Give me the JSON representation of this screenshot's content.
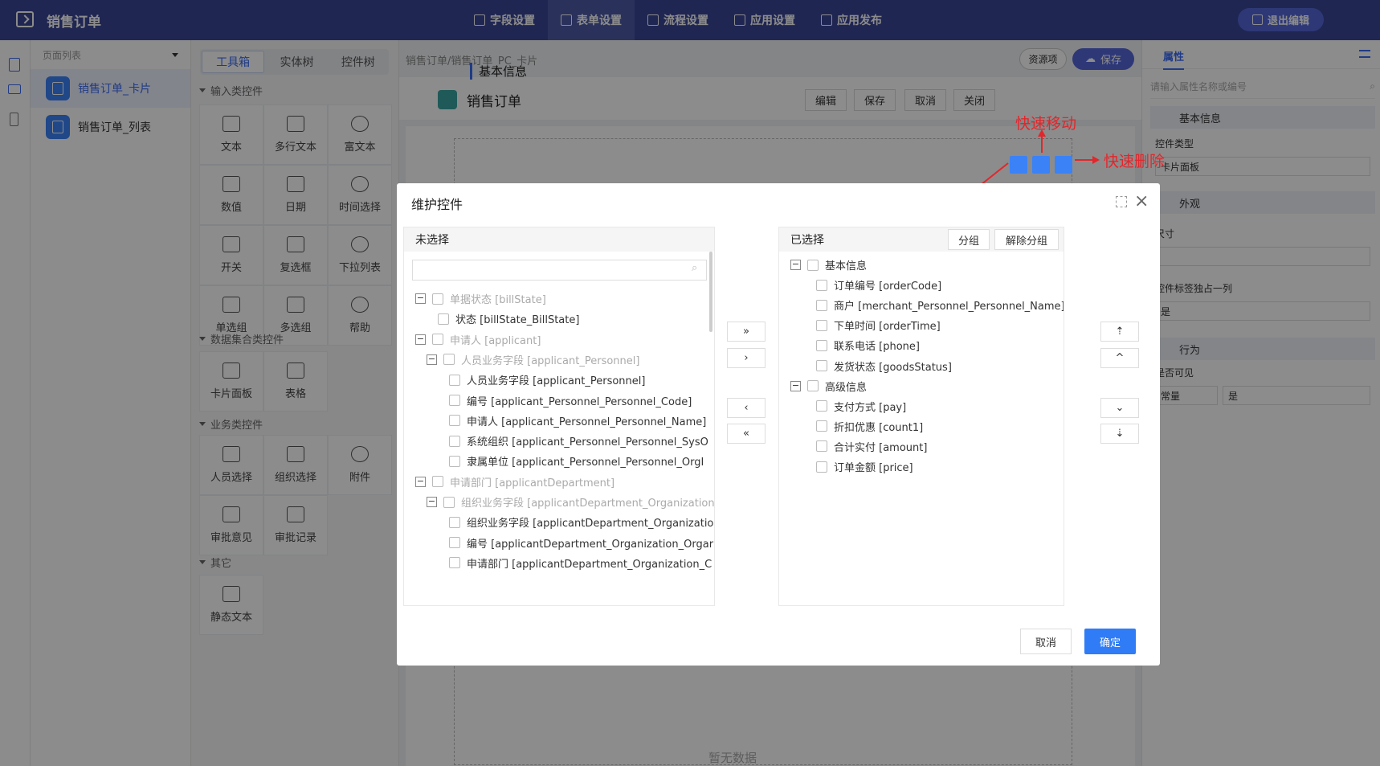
{
  "app": {
    "title": "销售订单",
    "exit_label": "退出编辑"
  },
  "topnav": [
    {
      "label": "字段设置",
      "active": false
    },
    {
      "label": "表单设置",
      "active": true
    },
    {
      "label": "流程设置",
      "active": false
    },
    {
      "label": "应用设置",
      "active": false
    },
    {
      "label": "应用发布",
      "active": false
    }
  ],
  "pagelist": {
    "header": "页面列表",
    "items": [
      {
        "label": "销售订单_卡片",
        "selected": true
      },
      {
        "label": "销售订单_列表",
        "selected": false
      }
    ]
  },
  "toolbox": {
    "tabs": [
      "工具箱",
      "实体树",
      "控件树"
    ],
    "sections": [
      {
        "title": "输入类控件",
        "items": [
          "文本",
          "多行文本",
          "富文本",
          "数值",
          "日期",
          "时间选择",
          "开关",
          "复选框",
          "下拉列表",
          "单选组",
          "多选组",
          "帮助"
        ]
      },
      {
        "title": "数据集合类控件",
        "items": [
          "卡片面板",
          "表格"
        ]
      },
      {
        "title": "业务类控件",
        "items": [
          "人员选择",
          "组织选择",
          "附件",
          "审批意见",
          "审批记录"
        ]
      },
      {
        "title": "其它",
        "items": [
          "静态文本"
        ]
      }
    ]
  },
  "canvas": {
    "breadcrumb": "销售订单/销售订单_PC_卡片",
    "resource_label": "资源项",
    "save_label": "保存",
    "form_title": "销售订单",
    "form_buttons": [
      "编辑",
      "保存",
      "取消",
      "关闭"
    ],
    "section_title": "基本信息",
    "empty_text": "暂无数据",
    "annotation_move": "快速移动",
    "annotation_delete": "快速删除"
  },
  "props": {
    "tab": "属性",
    "search_placeholder": "请输入属性名称或编号",
    "group_basic": "基本信息",
    "control_type_label": "控件类型",
    "control_type_value": "卡片面板",
    "group_look": "外观",
    "size_label": "尺寸",
    "label_own_column": "控件标签独占一列",
    "label_own_value": "是",
    "group_behavior": "行为",
    "visible_label": "是否可见",
    "visible_mode": "常量",
    "visible_value": "是"
  },
  "modal": {
    "title": "维护控件",
    "left_title": "未选择",
    "right_title": "已选择",
    "group_btn": "分组",
    "ungroup_btn": "解除分组",
    "cancel": "取消",
    "ok": "确定",
    "left_rows": [
      {
        "text": "单据状态 [billState]",
        "level": 0,
        "toggle": true,
        "dim": true
      },
      {
        "text": "状态 [billState_BillState]",
        "level": 1,
        "toggle": false,
        "dim": false
      },
      {
        "text": "申请人 [applicant]",
        "level": 0,
        "toggle": true,
        "dim": true
      },
      {
        "text": "人员业务字段 [applicant_Personnel]",
        "level": 1,
        "toggle": true,
        "dim": true
      },
      {
        "text": "人员业务字段 [applicant_Personnel]",
        "level": 2,
        "toggle": false,
        "dim": false
      },
      {
        "text": "编号 [applicant_Personnel_Personnel_Code]",
        "level": 2,
        "toggle": false,
        "dim": false
      },
      {
        "text": "申请人 [applicant_Personnel_Personnel_Name]",
        "level": 2,
        "toggle": false,
        "dim": false
      },
      {
        "text": "系统组织 [applicant_Personnel_Personnel_SysO",
        "level": 2,
        "toggle": false,
        "dim": false
      },
      {
        "text": "隶属单位 [applicant_Personnel_Personnel_OrgI",
        "level": 2,
        "toggle": false,
        "dim": false
      },
      {
        "text": "申请部门 [applicantDepartment]",
        "level": 0,
        "toggle": true,
        "dim": true
      },
      {
        "text": "组织业务字段 [applicantDepartment_Organization]",
        "level": 1,
        "toggle": true,
        "dim": true
      },
      {
        "text": "组织业务字段 [applicantDepartment_Organizatio",
        "level": 2,
        "toggle": false,
        "dim": false
      },
      {
        "text": "编号 [applicantDepartment_Organization_Orgar",
        "level": 2,
        "toggle": false,
        "dim": false
      },
      {
        "text": "申请部门 [applicantDepartment_Organization_C",
        "level": 2,
        "toggle": false,
        "dim": false
      }
    ],
    "right_rows": [
      {
        "text": "基本信息",
        "level": 0,
        "toggle": true
      },
      {
        "text": "订单编号 [orderCode]",
        "level": 1,
        "toggle": false
      },
      {
        "text": "商户 [merchant_Personnel_Personnel_Name]",
        "level": 1,
        "toggle": false
      },
      {
        "text": "下单时间 [orderTime]",
        "level": 1,
        "toggle": false
      },
      {
        "text": "联系电话 [phone]",
        "level": 1,
        "toggle": false
      },
      {
        "text": "发货状态 [goodsStatus]",
        "level": 1,
        "toggle": false
      },
      {
        "text": "高级信息",
        "level": 0,
        "toggle": true
      },
      {
        "text": "支付方式 [pay]",
        "level": 1,
        "toggle": false
      },
      {
        "text": "折扣优惠 [count1]",
        "level": 1,
        "toggle": false
      },
      {
        "text": "合计实付 [amount]",
        "level": 1,
        "toggle": false
      },
      {
        "text": "订单金额 [price]",
        "level": 1,
        "toggle": false
      }
    ],
    "transfer_buttons": [
      "»",
      "›",
      "‹",
      "«"
    ],
    "order_buttons": [
      "⇡",
      "^",
      "⌄",
      "⇣"
    ]
  }
}
